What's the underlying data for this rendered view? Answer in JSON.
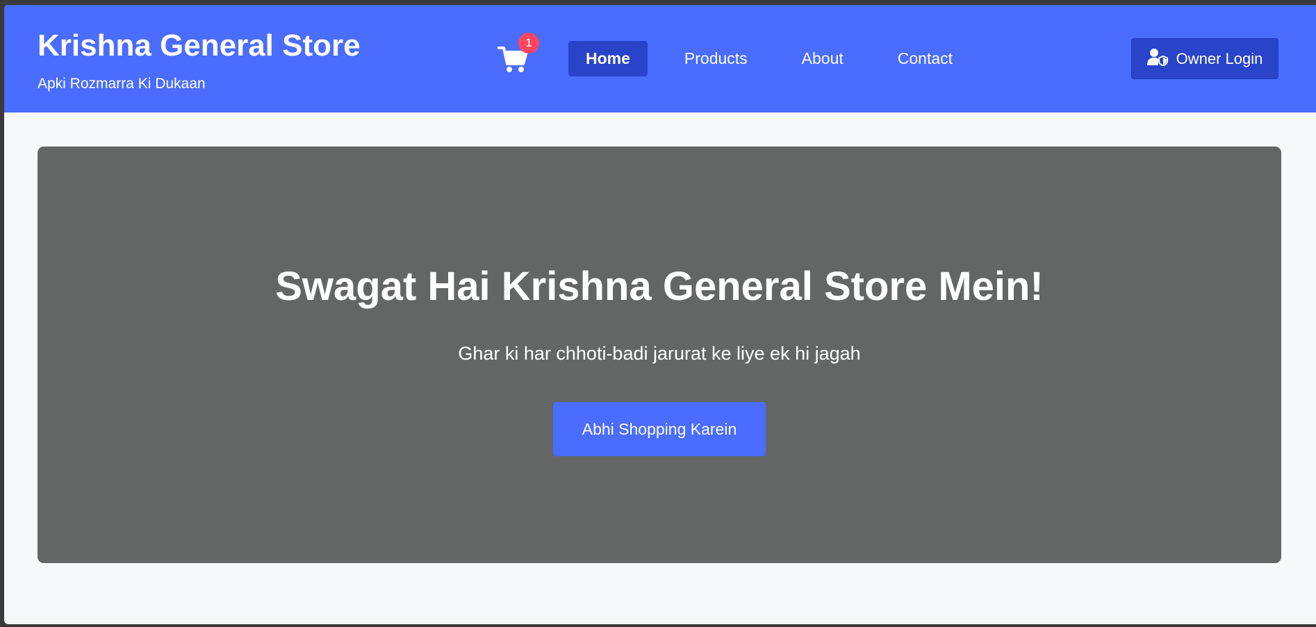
{
  "brand": {
    "title": "Krishna General Store",
    "tagline": "Apki Rozmarra Ki Dukaan"
  },
  "cart": {
    "icon": "shopping-cart-icon",
    "count": "1"
  },
  "nav": {
    "items": [
      {
        "label": "Home",
        "active": true
      },
      {
        "label": "Products",
        "active": false
      },
      {
        "label": "About",
        "active": false
      },
      {
        "label": "Contact",
        "active": false
      }
    ]
  },
  "owner_login": {
    "icon": "user-shield-icon",
    "label": "Owner Login"
  },
  "hero": {
    "title": "Swagat Hai Krishna General Store Mein!",
    "subtitle": "Ghar ki har chhoti-badi jarurat ke liye ek hi jagah",
    "cta_label": "Abhi Shopping Karein"
  },
  "colors": {
    "header_bg": "#4a6cff",
    "nav_active_bg": "#2944c9",
    "hero_bg": "#646665",
    "badge": "#ff4560",
    "page_bg": "#f7f8fa"
  }
}
